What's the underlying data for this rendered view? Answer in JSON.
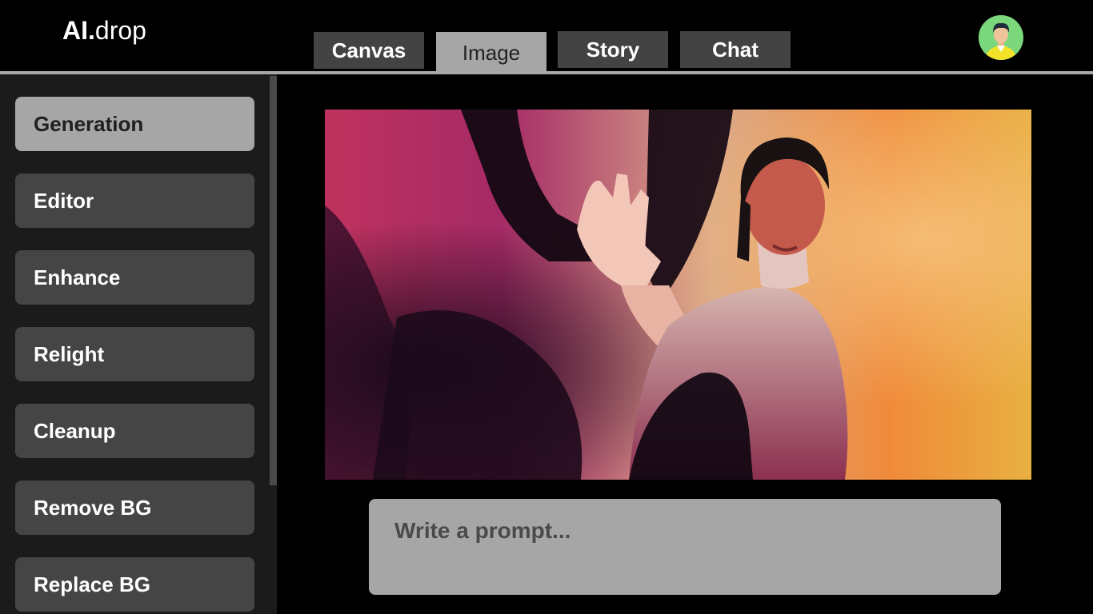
{
  "app": {
    "logo_bold": "AI.",
    "logo_light": "drop"
  },
  "tabs": [
    {
      "label": "Canvas",
      "active": false
    },
    {
      "label": "Image",
      "active": true
    },
    {
      "label": "Story",
      "active": false
    },
    {
      "label": "Chat",
      "active": false
    }
  ],
  "user": {
    "avatar_icon": "user-avatar-icon"
  },
  "sidebar": {
    "items": [
      {
        "label": "Generation",
        "active": true
      },
      {
        "label": "Editor",
        "active": false
      },
      {
        "label": "Enhance",
        "active": false
      },
      {
        "label": "Relight",
        "active": false
      },
      {
        "label": "Cleanup",
        "active": false
      },
      {
        "label": "Remove BG",
        "active": false
      },
      {
        "label": "Replace BG",
        "active": false
      }
    ]
  },
  "prompt": {
    "placeholder": "Write a prompt...",
    "value": ""
  },
  "colors": {
    "background": "#000000",
    "sidebar": "#1b1b1b",
    "button": "#454545",
    "active": "#a6a6a6",
    "avatar_bg": "#7bd77b"
  }
}
